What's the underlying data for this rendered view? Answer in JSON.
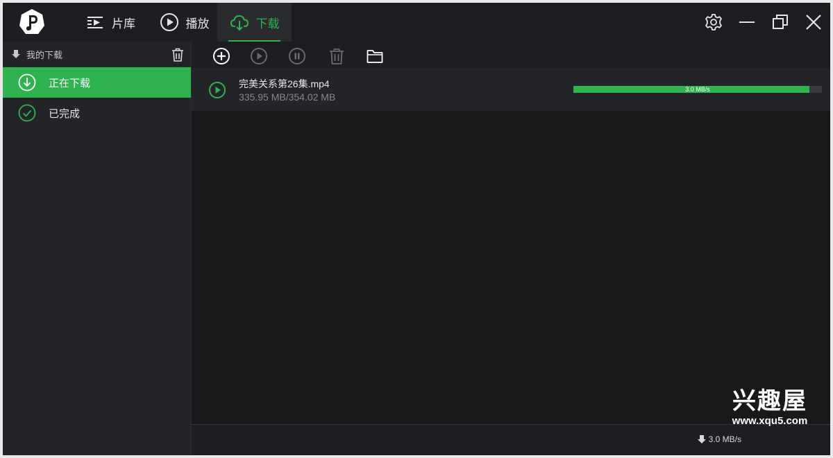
{
  "nav": {
    "tabs": [
      {
        "label": "片库",
        "icon": "library-icon"
      },
      {
        "label": "播放",
        "icon": "play-icon"
      },
      {
        "label": "下载",
        "icon": "cloud-download-icon",
        "active": true
      }
    ]
  },
  "sidebar": {
    "header": "我的下载",
    "items": [
      {
        "label": "正在下载",
        "active": true,
        "icon": "download-circle-icon"
      },
      {
        "label": "已完成",
        "active": false,
        "icon": "check-circle-icon"
      }
    ]
  },
  "toolbar": {
    "buttons": [
      "add-icon",
      "play-icon",
      "pause-icon",
      "trash-icon",
      "folder-icon"
    ]
  },
  "download": {
    "filename": "完美关系第26集.mp4",
    "size": "335.95 MB/354.02 MB",
    "speed": "3.0 MB/s",
    "progress": 0.949
  },
  "status": {
    "speed": "3.0 MB/s"
  },
  "watermark": {
    "title": "兴趣屋",
    "url": "www.xqu5.com"
  },
  "colors": {
    "accent": "#2fb351",
    "background": "#19191c",
    "sidebar": "#232428"
  }
}
